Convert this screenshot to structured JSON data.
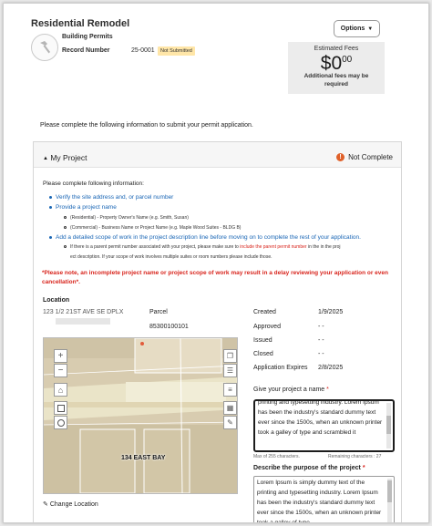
{
  "header": {
    "title": "Residential Remodel",
    "subtype": "Building Permits",
    "record_label": "Record Number",
    "record_number": "25-0001",
    "status_badge": "Not Submitted",
    "options_label": "Options",
    "fees": {
      "label": "Estimated Fees",
      "amount": "0",
      "currency": "$",
      "cents": "00",
      "note": "Additional fees may be required"
    }
  },
  "instructions": "Please complete the following information to submit your permit application.",
  "section": {
    "title": "My Project",
    "status": "Not Complete",
    "fill_info": "Please complete following information:",
    "items": [
      "Verify the site address and, or parcel number",
      "Provide a project name",
      "Add a detailed scope of work in the project description line before moving on to complete the rest of your application."
    ],
    "subitems": [
      "(Residential) - Property Owner's Name (e.g. Smith, Susan)",
      "(Commercial) - Business Name or Project Name (e.g. Maple Wood Suites - BLDG B)"
    ],
    "parent_note_pre": "If there is a parent permit number associated with your project, please make sure to",
    "parent_note_link": "include the parent permit number",
    "parent_note_post": "in the in the proj",
    "parent_note_line2": "ect description. If your scope of work involves multiple suites or room numbers please include those.",
    "warning": "*Please note, an incomplete project name or project scope of work may result in a delay reviewing your application or even cancellation*.",
    "location_label": "Location",
    "address": "123 1/2 21ST AVE SE DPLX",
    "parcel_label": "Parcel",
    "parcel_number": "85300100101",
    "change_location": "Change Location",
    "map_label": "134 EAST BAY",
    "meta": [
      {
        "label": "Created",
        "value": "1/9/2025"
      },
      {
        "label": "Approved",
        "value": "- -"
      },
      {
        "label": "Issued",
        "value": "- -"
      },
      {
        "label": "Closed",
        "value": "- -"
      },
      {
        "label": "Application Expires",
        "value": "2/8/2025"
      }
    ],
    "name_label": "Give your project a name",
    "name_value": "printing and typesetting industry. Lorem Ipsum has been the industry's standard dummy text ever since the 1500s, when an unknown printer took a galley of type and scrambled it",
    "max_chars": "Max of 255 characters.",
    "remaining": "Remaining characters : 27",
    "desc_label": "Describe the purpose of the project",
    "desc_value": "Lorem Ipsum is simply dummy text of the printing and typesetting industry. Lorem Ipsum has been the industry's standard dummy text ever since the 1500s, when an unknown printer took a galley of type"
  },
  "colors": {
    "link_blue": "#1865b5",
    "warning_red": "#d8241c",
    "alert_orange": "#e0612a",
    "badge_yellow": "#ffe6a8"
  }
}
